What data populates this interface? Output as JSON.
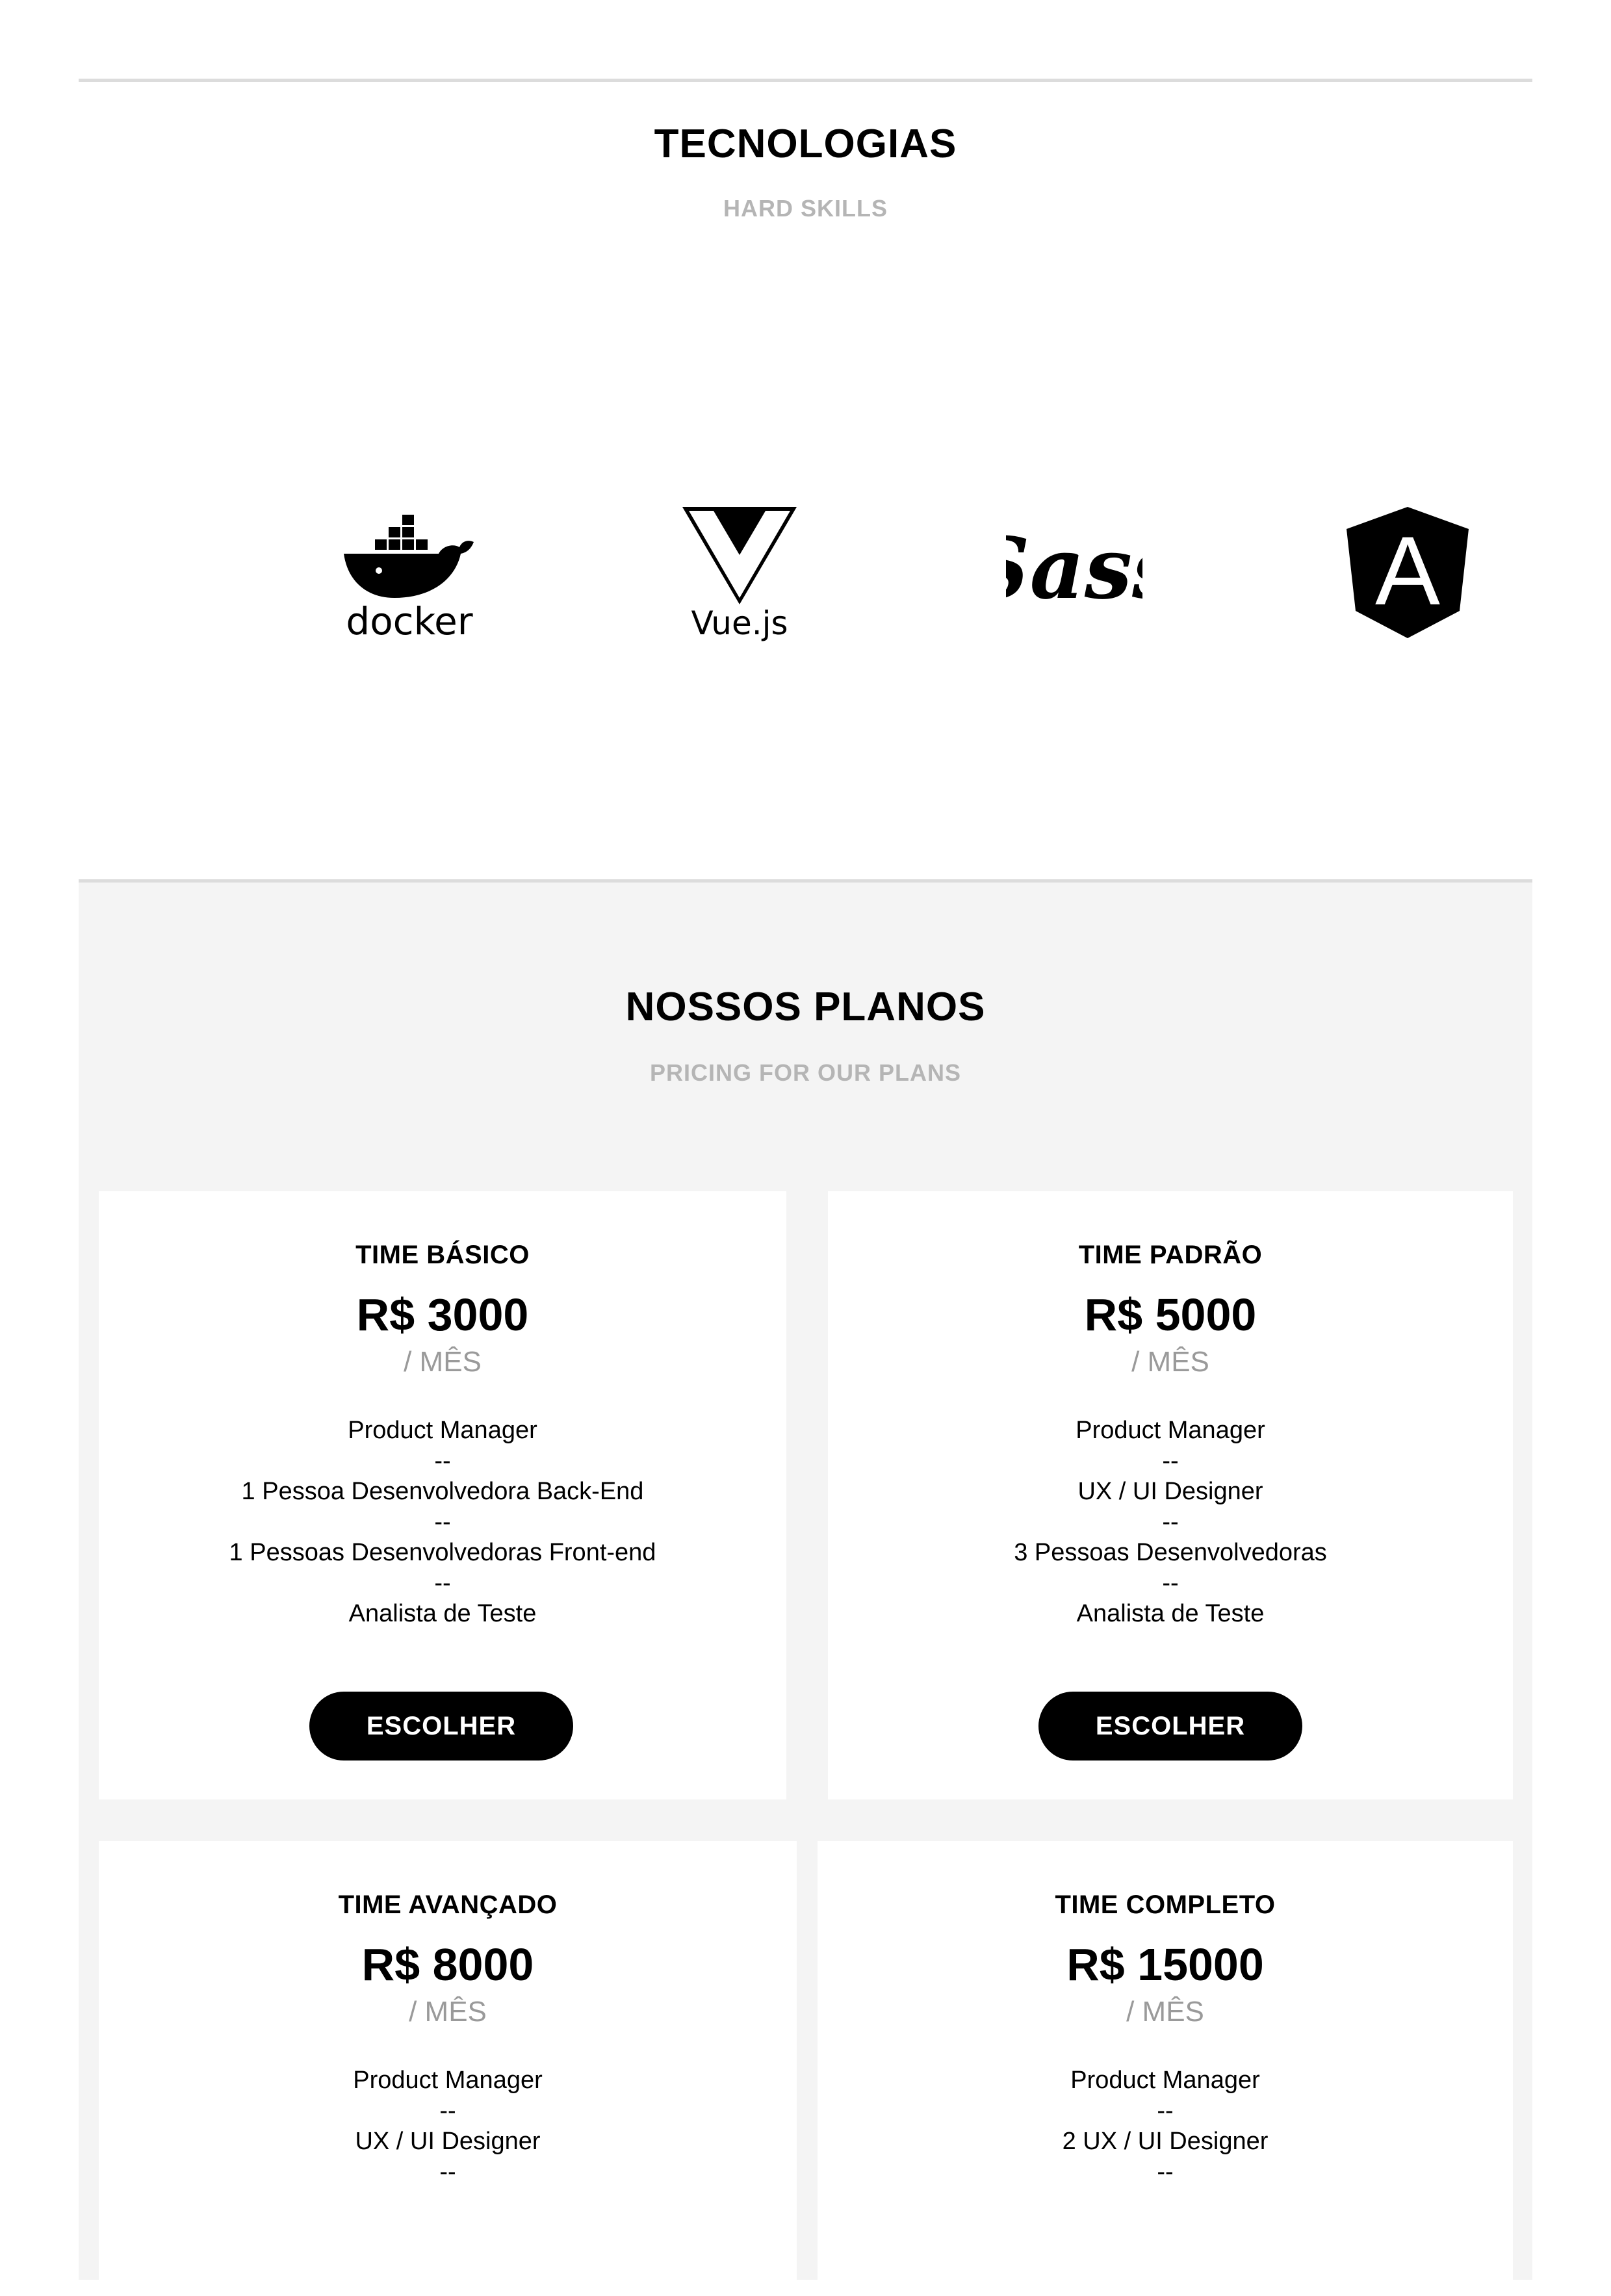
{
  "tech": {
    "title": "TECNOLOGIAS",
    "subtitle": "HARD SKILLS",
    "logos": [
      {
        "icon": "docker-logo",
        "label": "docker"
      },
      {
        "icon": "vuejs-logo",
        "label": "Vue.js"
      },
      {
        "icon": "sass-logo",
        "label": "Sass"
      },
      {
        "icon": "angular-logo",
        "label": "A"
      }
    ]
  },
  "pricing": {
    "title": "NOSSOS PLANOS",
    "subtitle": "PRICING FOR OUR PLANS",
    "plans": [
      {
        "name": "TIME BÁSICO",
        "price": "R$ 3000",
        "period": "/ MÊS",
        "features": [
          "Product Manager",
          "--",
          "1 Pessoa Desenvolvedora Back-End",
          "--",
          "1 Pessoas Desenvolvedoras Front-end",
          "--",
          "Analista de Teste"
        ],
        "button": "ESCOLHER"
      },
      {
        "name": "TIME PADRÃO",
        "price": "R$ 5000",
        "period": "/ MÊS",
        "features": [
          "Product Manager",
          "--",
          "UX / UI Designer",
          "--",
          "3 Pessoas Desenvolvedoras",
          "--",
          "Analista de Teste"
        ],
        "button": "ESCOLHER"
      },
      {
        "name": "TIME AVANÇADO",
        "price": "R$ 8000",
        "period": "/ MÊS",
        "features": [
          "Product Manager",
          "--",
          "UX / UI Designer",
          "--"
        ]
      },
      {
        "name": "TIME COMPLETO",
        "price": "R$ 15000",
        "period": "/ MÊS",
        "features": [
          "Product Manager",
          "--",
          "2 UX / UI Designer",
          "--"
        ]
      }
    ]
  }
}
